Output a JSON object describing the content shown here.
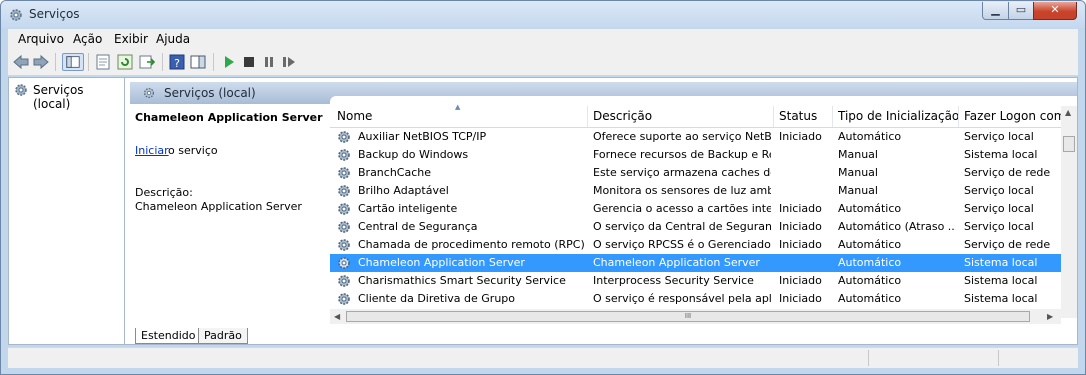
{
  "window": {
    "title": "Serviços",
    "min_icon": "minimize-icon",
    "max_icon": "maximize-icon",
    "close_icon": "close-icon"
  },
  "menu": [
    "Arquivo",
    "Ação",
    "Exibir",
    "Ajuda"
  ],
  "toolbar": {
    "icons": [
      "back-icon",
      "forward-icon",
      "console-tree-icon",
      "properties-icon",
      "refresh-icon",
      "export-list-icon",
      "help-icon",
      "show-hide-action-pane-icon",
      "start-service-icon",
      "stop-service-icon",
      "pause-service-icon",
      "restart-service-icon"
    ]
  },
  "tree": {
    "item": "Serviços (local)"
  },
  "header": {
    "title": "Serviços (local)"
  },
  "detail": {
    "service_name": "Chameleon Application Server",
    "start_link": "Iniciar",
    "start_rest": "o serviço",
    "desc_label": "Descrição:",
    "desc_value": "Chameleon Application Server"
  },
  "columns": [
    "Nome",
    "Descrição",
    "Status",
    "Tipo de Inicialização",
    "Fazer Logon como"
  ],
  "rows": [
    [
      "Auxiliar NetBIOS TCP/IP",
      "Oferece suporte ao serviço NetBI...",
      "Iniciado",
      "Automático",
      "Serviço local"
    ],
    [
      "Backup do Windows",
      "Fornece recursos de Backup e Re...",
      "",
      "Manual",
      "Sistema local"
    ],
    [
      "BranchCache",
      "Este serviço armazena caches de ...",
      "",
      "Manual",
      "Serviço de rede"
    ],
    [
      "Brilho Adaptável",
      "Monitora os sensores de luz amb...",
      "",
      "Manual",
      "Serviço local"
    ],
    [
      "Cartão inteligente",
      "Gerencia o acesso a cartões inteli...",
      "Iniciado",
      "Automático",
      "Serviço local"
    ],
    [
      "Central de Segurança",
      "O serviço da Central de Seguranç...",
      "Iniciado",
      "Automático (Atraso ...",
      "Serviço local"
    ],
    [
      "Chamada de procedimento remoto (RPC)",
      "O serviço RPCSS é o Gerenciador...",
      "Iniciado",
      "Automático",
      "Serviço de rede"
    ],
    [
      "Chameleon Application Server",
      "Chameleon Application Server",
      "",
      "Automático",
      "Sistema local"
    ],
    [
      "Charismathics Smart Security Service",
      "Interprocess Security Service",
      "Iniciado",
      "Automático",
      "Sistema local"
    ],
    [
      "Cliente da Diretiva de Grupo",
      "O serviço é responsável pela apli...",
      "Iniciado",
      "Automático",
      "Sistema local"
    ]
  ],
  "selected_row": 7,
  "hscroll_grip": "III",
  "tabs": [
    "Estendido",
    "Padrão"
  ],
  "colors": {
    "selection": "#3399ff",
    "link": "#0033cc"
  }
}
